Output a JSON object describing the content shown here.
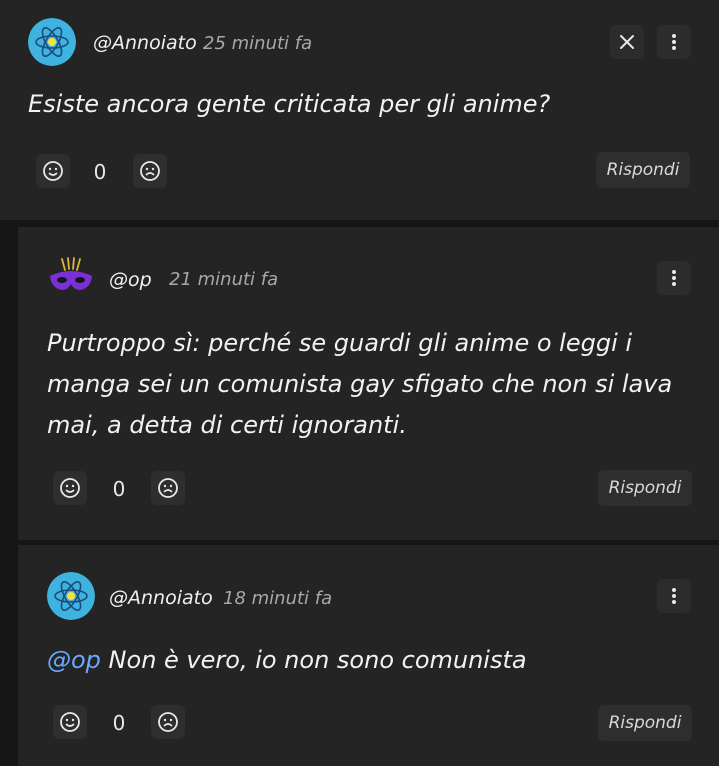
{
  "comments": [
    {
      "username": "@Annoiato",
      "time": "25 minuti fa",
      "text": "Esiste ancora gente criticata per gli anime?",
      "votes": "0",
      "reply_label": "Rispondi",
      "avatar_icon": "atom-avatar-icon"
    },
    {
      "username": "@op",
      "time": "21 minuti fa",
      "text_line1": "Purtroppo sì: perché se guardi gli anime o leggi i",
      "text_line2": "manga sei un comunista gay sfigato che non si lava",
      "text_line3": "mai, a detta di certi ignoranti.",
      "votes": "0",
      "reply_label": "Rispondi",
      "avatar_icon": "mask-avatar-icon"
    },
    {
      "username": "@Annoiato",
      "time": "18 minuti fa",
      "mention": "@op",
      "text": " Non è vero, io non sono comunista",
      "votes": "0",
      "reply_label": "Rispondi",
      "avatar_icon": "atom-avatar-icon"
    }
  ],
  "colors": {
    "background": "#161616",
    "card": "#242424",
    "mention": "#6aa9ff",
    "mask": "#7b2fd6"
  }
}
